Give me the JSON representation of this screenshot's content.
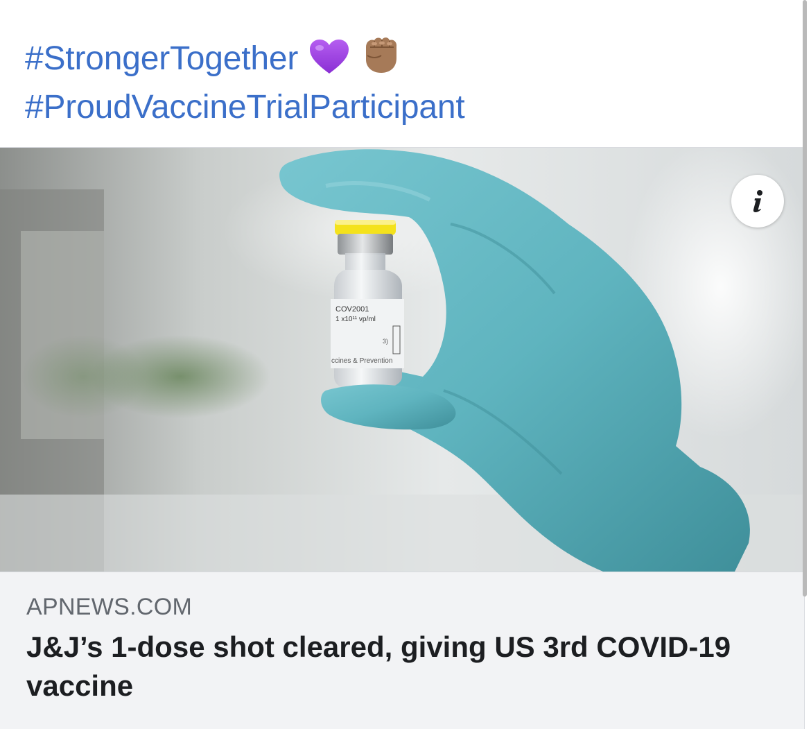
{
  "post": {
    "hashtags": [
      "#StrongerTogether",
      "#ProudVaccineTrialParticipant"
    ],
    "emojis": [
      "purple-heart-icon",
      "fist-bump-icon"
    ]
  },
  "link_card": {
    "domain": "APNEWS.COM",
    "headline": "J&J’s 1-dose shot cleared, giving US 3rd COVID-19 vaccine",
    "image": {
      "description": "Gloved hand holding vaccine vial",
      "vial_label_lines": [
        "COV2001",
        "1 x10¹¹ vp/ml",
        "3)",
        "ccines & Prevention"
      ]
    },
    "info_icon": "i"
  },
  "colors": {
    "hashtag": "#3b6fc9",
    "glove": "#5fb4bf",
    "vial_cap": "#f4e21c"
  }
}
